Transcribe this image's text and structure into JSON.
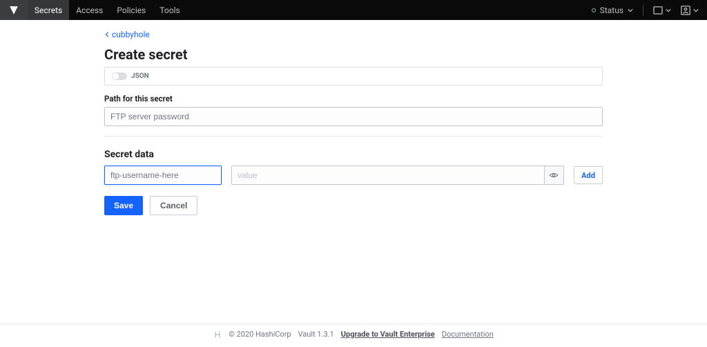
{
  "nav": {
    "items": [
      "Secrets",
      "Access",
      "Policies",
      "Tools"
    ],
    "status_label": "Status"
  },
  "breadcrumb": {
    "parent": "cubbyhole"
  },
  "page": {
    "title": "Create secret",
    "json_label": "JSON",
    "path_label": "Path for this secret",
    "path_value": "FTP server password",
    "section_title": "Secret data",
    "key_value": "ftp-username-here",
    "value_placeholder": "value",
    "add_label": "Add",
    "save_label": "Save",
    "cancel_label": "Cancel"
  },
  "footer": {
    "copyright": "© 2020 HashiCorp",
    "version": "Vault 1.3.1",
    "upgrade": "Upgrade to Vault Enterprise",
    "docs": "Documentation"
  }
}
